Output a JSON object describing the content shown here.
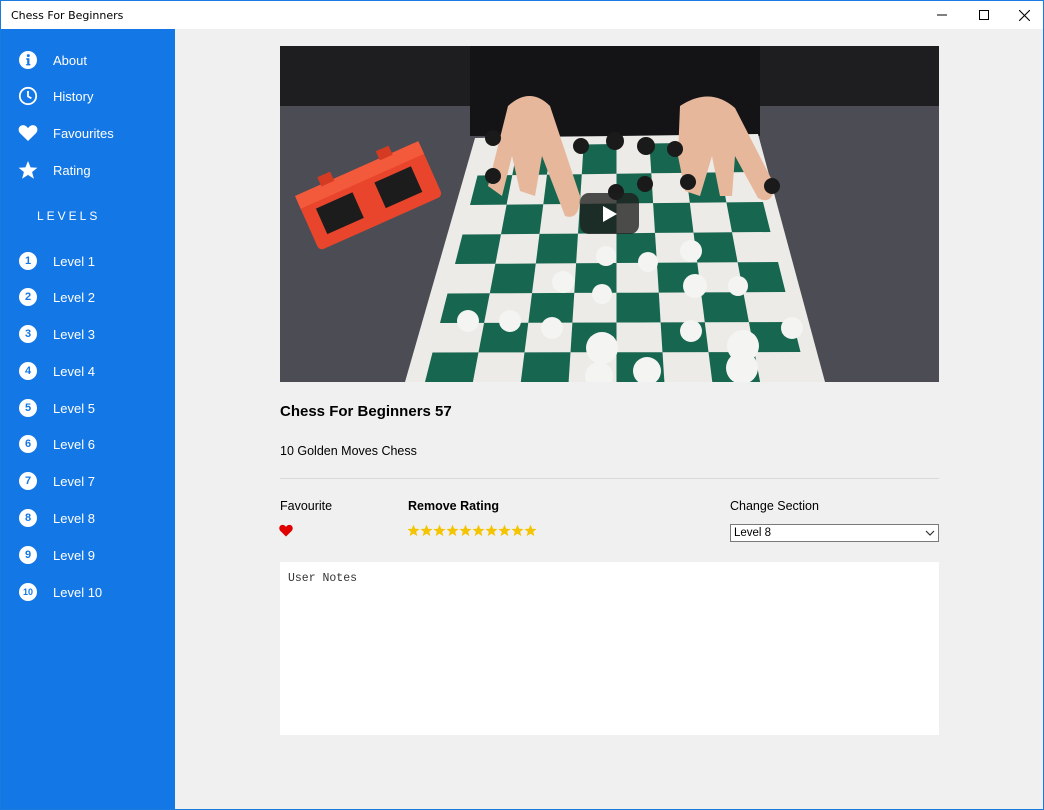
{
  "window": {
    "title": "Chess For Beginners"
  },
  "sidebar": {
    "items": [
      {
        "label": "About",
        "icon": "info-icon"
      },
      {
        "label": "History",
        "icon": "clock-icon"
      },
      {
        "label": "Favourites",
        "icon": "heart-icon"
      },
      {
        "label": "Rating",
        "icon": "star-icon"
      }
    ],
    "levels_heading": "LEVELS",
    "levels": [
      {
        "num": "1",
        "label": "Level 1"
      },
      {
        "num": "2",
        "label": "Level 2"
      },
      {
        "num": "3",
        "label": "Level 3"
      },
      {
        "num": "4",
        "label": "Level 4"
      },
      {
        "num": "5",
        "label": "Level 5"
      },
      {
        "num": "6",
        "label": "Level 6"
      },
      {
        "num": "7",
        "label": "Level 7"
      },
      {
        "num": "8",
        "label": "Level 8"
      },
      {
        "num": "9",
        "label": "Level 9"
      },
      {
        "num": "10",
        "label": "Level 10"
      }
    ]
  },
  "video": {
    "title": "Chess For Beginners 57",
    "subtitle": "10 Golden Moves Chess"
  },
  "controls": {
    "favourite_label": "Favourite",
    "favourite_icon": "heart-icon",
    "rating_label": "Remove Rating",
    "rating_stars": 10,
    "section_label": "Change Section",
    "section_selected": "Level 8"
  },
  "notes": {
    "placeholder": "User Notes"
  },
  "colors": {
    "sidebar": "#1477e6",
    "heart": "#e00000",
    "star": "#f5c400",
    "background": "#f0f0f0"
  }
}
